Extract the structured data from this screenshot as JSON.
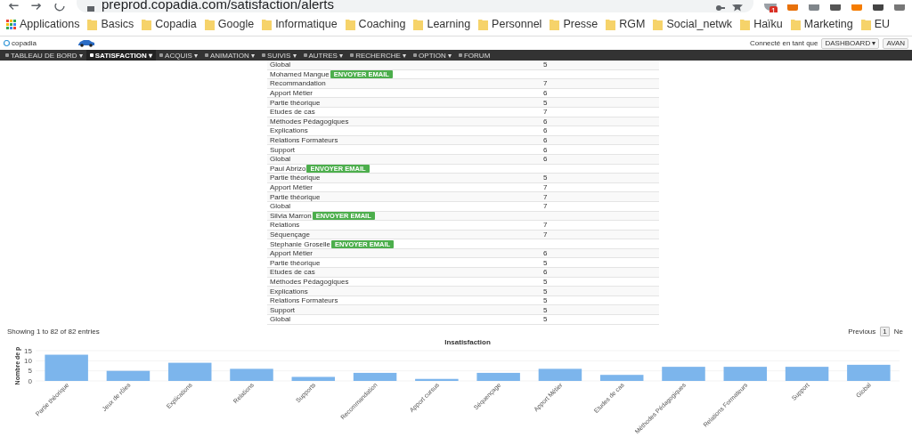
{
  "browser": {
    "url": "preprod.copadia.com/satisfaction/alerts",
    "extension_badge": "1",
    "bookmarks": [
      {
        "label": "Applications",
        "kind": "apps"
      },
      {
        "label": "Basics",
        "kind": "folder"
      },
      {
        "label": "Copadia",
        "kind": "folder"
      },
      {
        "label": "Google",
        "kind": "folder"
      },
      {
        "label": "Informatique",
        "kind": "folder"
      },
      {
        "label": "Coaching",
        "kind": "folder"
      },
      {
        "label": "Learning",
        "kind": "folder"
      },
      {
        "label": "Personnel",
        "kind": "folder"
      },
      {
        "label": "Presse",
        "kind": "folder"
      },
      {
        "label": "RGM",
        "kind": "folder"
      },
      {
        "label": "Social_netwk",
        "kind": "folder"
      },
      {
        "label": "Haïku",
        "kind": "folder"
      },
      {
        "label": "Marketing",
        "kind": "folder"
      },
      {
        "label": "EU",
        "kind": "folder"
      }
    ]
  },
  "header": {
    "logo": "copadia",
    "user_label": "Connecté en tant que",
    "buttons": [
      "DASHBOARD ▾",
      "AVAN"
    ]
  },
  "nav": [
    {
      "label": "TABLEAU DE BORD ▾",
      "selected": false
    },
    {
      "label": "SATISFACTION ▾",
      "selected": true
    },
    {
      "label": "ACQUIS ▾",
      "selected": false
    },
    {
      "label": "ANIMATION ▾",
      "selected": false
    },
    {
      "label": "SUIVIS ▾",
      "selected": false
    },
    {
      "label": "AUTRES ▾",
      "selected": false
    },
    {
      "label": "RECHERCHE ▾",
      "selected": false
    },
    {
      "label": "OPTION ▾",
      "selected": false
    },
    {
      "label": "FORUM",
      "selected": false
    }
  ],
  "table": {
    "rows": [
      {
        "kind": "score",
        "label": "Global",
        "value": "5"
      },
      {
        "kind": "person",
        "label": "Mohamed Mangue",
        "button": "ENVOYER EMAIL"
      },
      {
        "kind": "score",
        "label": "Recommandation",
        "value": "7"
      },
      {
        "kind": "score",
        "label": "Apport Métier",
        "value": "6"
      },
      {
        "kind": "score",
        "label": "Partie théorique",
        "value": "5"
      },
      {
        "kind": "score",
        "label": "Etudes de cas",
        "value": "7"
      },
      {
        "kind": "score",
        "label": "Méthodes Pédagogiques",
        "value": "6"
      },
      {
        "kind": "score",
        "label": "Explications",
        "value": "6"
      },
      {
        "kind": "score",
        "label": "Relations Formateurs",
        "value": "6"
      },
      {
        "kind": "score",
        "label": "Support",
        "value": "6"
      },
      {
        "kind": "score",
        "label": "Global",
        "value": "6"
      },
      {
        "kind": "person",
        "label": "Paul Abrizo",
        "button": "ENVOYER EMAIL"
      },
      {
        "kind": "score",
        "label": "Partie théorique",
        "value": "5"
      },
      {
        "kind": "score",
        "label": "Apport Métier",
        "value": "7"
      },
      {
        "kind": "score",
        "label": "Partie théorique",
        "value": "7"
      },
      {
        "kind": "score",
        "label": "Global",
        "value": "7"
      },
      {
        "kind": "person",
        "label": "Silvia Marron",
        "button": "ENVOYER EMAIL"
      },
      {
        "kind": "score",
        "label": "Relations",
        "value": "7"
      },
      {
        "kind": "score",
        "label": "Séquençage",
        "value": "7"
      },
      {
        "kind": "person",
        "label": "Stephanie Groselle",
        "button": "ENVOYER EMAIL"
      },
      {
        "kind": "score",
        "label": "Apport Métier",
        "value": "6"
      },
      {
        "kind": "score",
        "label": "Partie théorique",
        "value": "5"
      },
      {
        "kind": "score",
        "label": "Etudes de cas",
        "value": "6"
      },
      {
        "kind": "score",
        "label": "Méthodes Pédagogiques",
        "value": "5"
      },
      {
        "kind": "score",
        "label": "Explications",
        "value": "5"
      },
      {
        "kind": "score",
        "label": "Relations Formateurs",
        "value": "5"
      },
      {
        "kind": "score",
        "label": "Support",
        "value": "5"
      },
      {
        "kind": "score",
        "label": "Global",
        "value": "5"
      }
    ],
    "info": "Showing 1 to 82 of 82 entries",
    "pagination": [
      {
        "label": "Previous",
        "selected": false
      },
      {
        "label": "1",
        "selected": true
      },
      {
        "label": "Ne",
        "selected": false
      }
    ]
  },
  "chart": {
    "chart_data": {
      "type": "bar",
      "title": "Insatisfaction",
      "ylabel": "Nombre de p",
      "categories": [
        "Partie théorique",
        "Jeux de rôles",
        "Explications",
        "Relations",
        "Supports",
        "Recommandation",
        "Apport cursus",
        "Séquençage",
        "Apport Métier",
        "Etudes de cas",
        "Méthodes Pédagogiques",
        "Relations Formateurs",
        "Support",
        "Global"
      ],
      "series": [
        {
          "color": "#7cb5ec",
          "values": [
            13,
            5,
            9,
            6,
            2,
            4,
            1,
            4,
            6,
            3,
            7,
            7,
            7,
            8
          ]
        }
      ],
      "ylim": [
        0,
        15
      ],
      "yticks": [
        0,
        5,
        10,
        15
      ]
    }
  }
}
